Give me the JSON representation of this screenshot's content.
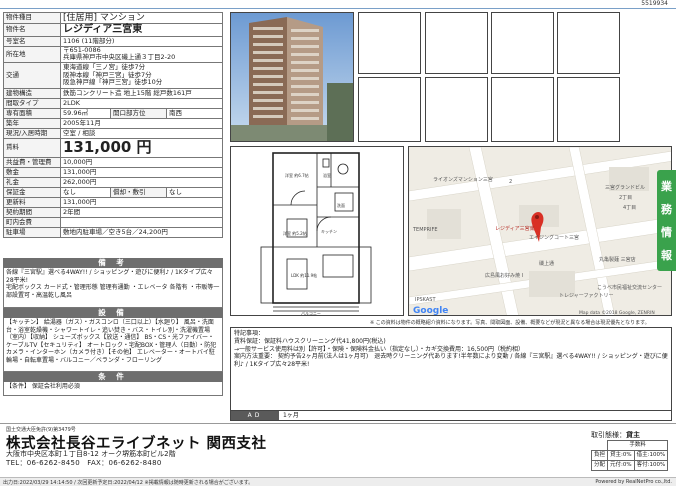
{
  "sheet_id": "5519934",
  "property": {
    "rows": [
      {
        "label": "物件種目",
        "value": "[住居用] マンション"
      },
      {
        "label": "物件名",
        "value": "レジディア三宮東"
      },
      {
        "label": "号室名",
        "value": "1106 (11階部分)"
      },
      {
        "label": "所在地",
        "value": "〒651-0086\n兵庫県神戸市中央区磯上通３丁目2-20"
      },
      {
        "label": "交通",
        "value": "東海道線「三ノ宮」徒歩7分\n阪神本線「神戸三宮」徒歩7分\n阪急神戸線「神戸三宮」徒歩10分"
      },
      {
        "label": "建物構造",
        "value": "鉄筋コンクリート造 地上15階 総戸数161戸"
      },
      {
        "label": "間取タイプ",
        "value": "2LDK"
      },
      {
        "label": "専有面積",
        "value": "59.96㎡",
        "extra_label": "開口部方位",
        "extra_value": "南西"
      },
      {
        "label": "築年",
        "value": "2005年11月"
      },
      {
        "label": "現況/入居時期",
        "value": "空室 / 相談"
      },
      {
        "label": "賃料",
        "value": "131,000 円"
      },
      {
        "label": "共益費・管理費",
        "value": "10,000円"
      },
      {
        "label": "敷金",
        "value": "131,000円"
      },
      {
        "label": "礼金",
        "value": "262,000円"
      },
      {
        "label": "保証金",
        "value": "なし",
        "extra_label": "償却・敷引",
        "extra_value": "なし"
      },
      {
        "label": "更新料",
        "value": "131,000円"
      },
      {
        "label": "契約期間",
        "value": "2年間"
      },
      {
        "label": "町内会費",
        "value": ""
      },
      {
        "label": "駐車場",
        "value": "敷地内駐車場／空き5台／24,200円"
      }
    ]
  },
  "sections": {
    "bikou": {
      "title": "備 考",
      "text": "各線『三宮駅』選べる4WAY!! / ショッピング・遊びに便利♪ / 1Kタイプ広々28平米!\n宅配ボックス カード式・管理形態 管理有通勤 ・エレベータ 各階有 ・市販等一部設置可・高温乾し風呂"
    },
    "setsubi": {
      "title": "設 備",
      "text": "【キッチン】 給湯器（ガス）・ガスコンロ（三口以上）【水廻り】 風呂・洗面台・浴室乾燥機・シャワートイレ・追い焚き・バス・トイレ別・洗濯機置場（室内）【収納】 シューズボックス【放送・通信】 BS・CS・光ファイバー・ケーブルTV【セキュリティ】 オートロック・宅配BOX・管理人（日勤）・防犯カメラ・インターホン（カメラ付き）【その他】 エレベーター・オートバイ駐輪場・自転車置場・バルコニー／ベランダ・フローリング"
    },
    "jouken": {
      "title": "条 件",
      "text": "【条件】 保証会社利用必須"
    }
  },
  "map": {
    "labels": [
      "レジディア三宮東",
      "エイジングコート三宮",
      "磯上通",
      "三宮グランドビル",
      "丸亀製麺 三宮店",
      "広島風お好み焼 Ⅰ",
      "トレジャーファクトリー",
      "こうべ市民福祉交流センター",
      "IPSKAST",
      "ライオンズマンション三宮",
      "TEMPRIFE",
      "4丁目",
      "2丁目",
      "2"
    ],
    "google_label": "Google",
    "attribution": "Map data ©2018 Google, ZENRIN",
    "pin_color": "#d93025"
  },
  "data_note": "※ この資料は物件の概略紹介資料になります。写真、間取図面、設備、概要などが現況と異なる場合は現況優先となります。",
  "remarks": {
    "title": "特記事項：",
    "lines": [
      "賃料保証：保証料ハウスクリーニング代41,800円(税込)",
      "→一般サービス使用料は別【許可】・保険・保険料金払い（指定なし）・カギ交換費用：16,500円（税約相）",
      "案内方法重要： 契約予告2ヶ月前(法人は1ヶ月可)　退去時クリーニング代あります!半年数により変動 / 各線『三宮駅』選べる4WAY!! / ショッピング・遊びに便利♪ / 1Kタイプ広々28平米!"
    ]
  },
  "ad": {
    "label": "AD",
    "value": "1ヶ月"
  },
  "side_tab": [
    "業",
    "務",
    "情",
    "報"
  ],
  "company": {
    "license": "国土交通大臣免許(9)第3479号",
    "name": "株式会社長谷エライブネット 関西支社",
    "address": "大阪市中央区本町１丁目8-12 オーク堺筋本町ビル2階",
    "tel": "TEL：06-6262-8450　FAX：06-6262-8480"
  },
  "deal": {
    "label": "取引態様：",
    "value": "貸主",
    "header": "手数料",
    "rows": [
      {
        "type": "負担",
        "a": "貸主:0%",
        "b": "借主:100%"
      },
      {
        "type": "分配",
        "a": "元付:0%",
        "b": "客付:100%"
      }
    ]
  },
  "footer": {
    "left": "出力日:2022/03/29 14:14:50 / 次回更新予定日:2022/04/12 ※掲載情報は随時更新される場合がございます。",
    "right": "Powered by RealNetPro co.,ltd."
  },
  "colors": {
    "accent": "#3aa24c",
    "section_header": "#6e6e6e"
  }
}
